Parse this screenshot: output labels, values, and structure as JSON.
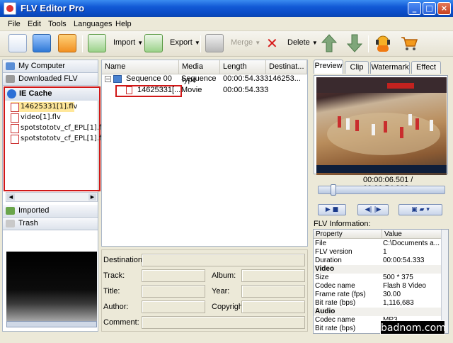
{
  "window": {
    "title": "FLV Editor Pro",
    "minimize": "_",
    "maximize": "□",
    "close": "×"
  },
  "menu": [
    "File",
    "Edit",
    "Tools",
    "Languages",
    "Help"
  ],
  "toolbar": {
    "import": "Import",
    "export": "Export",
    "merge": "Merge",
    "delete": "Delete"
  },
  "left_nav": {
    "my_computer": "My Computer",
    "downloaded_flv": "Downloaded FLV",
    "ie_cache": "IE Cache",
    "files": [
      "14625331[1].flv",
      "video[1].flv",
      "spotstototv_cf_EPL[1].fl",
      "spotstototv_cf_EPL[1].fl"
    ],
    "imported": "Imported",
    "trash": "Trash"
  },
  "timeline": {
    "columns": [
      "Name",
      "Media type",
      "Length",
      "Destinat..."
    ],
    "rows": [
      {
        "name": "Sequence 00",
        "type": "Sequence",
        "length": "00:00:54.333",
        "dest": "146253..."
      },
      {
        "name": "14625331[...",
        "type": "Movie",
        "length": "00:00:54.333",
        "dest": ""
      }
    ]
  },
  "form": {
    "destination": "Destination:",
    "track": "Track:",
    "album": "Album:",
    "title": "Title:",
    "year": "Year:",
    "author": "Author:",
    "copyright": "Copyright:",
    "comment": "Comment:"
  },
  "preview": {
    "tabs": [
      "Preview",
      "Clip",
      "Watermark",
      "Effect"
    ],
    "timecode": "00:00:06.501 / 00:00:54.333",
    "position_fraction": 0.12,
    "flv_info_label": "FLV Information:",
    "prop_headers": [
      "Property",
      "Value"
    ],
    "props": [
      {
        "k": "File",
        "v": "C:\\Documents a..."
      },
      {
        "k": "FLV version",
        "v": "1"
      },
      {
        "k": "Duration",
        "v": "00:00:54.333"
      },
      {
        "k": "Video",
        "v": "",
        "section": true
      },
      {
        "k": "Size",
        "v": "500 * 375"
      },
      {
        "k": "Codec name",
        "v": "Flash 8 Video"
      },
      {
        "k": "Frame rate (fps)",
        "v": "30.00"
      },
      {
        "k": "Bit rate (bps)",
        "v": "1,116,683"
      },
      {
        "k": "Audio",
        "v": "",
        "section": true
      },
      {
        "k": "Codec name",
        "v": "MP3"
      },
      {
        "k": "Bit rate (bps)",
        "v": ""
      }
    ]
  },
  "watermark": "badnom.com"
}
